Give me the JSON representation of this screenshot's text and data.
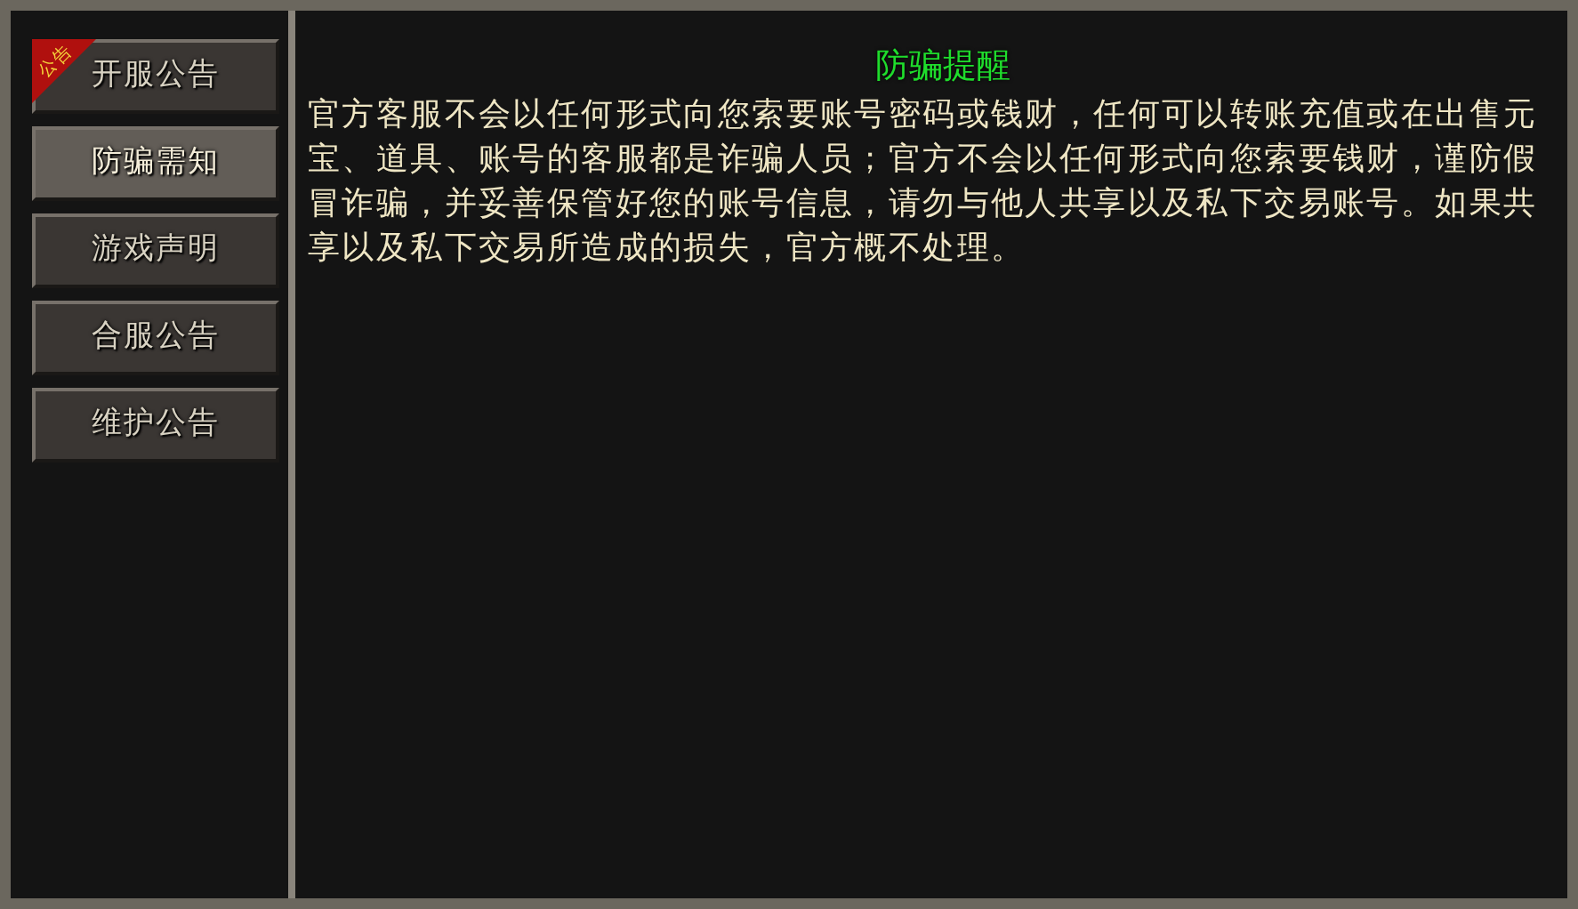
{
  "sidebar": {
    "items": [
      {
        "label": "开服公告",
        "selected": false,
        "badge": "公告"
      },
      {
        "label": "防骗需知",
        "selected": true
      },
      {
        "label": "游戏声明",
        "selected": false
      },
      {
        "label": "合服公告",
        "selected": false
      },
      {
        "label": "维护公告",
        "selected": false
      }
    ]
  },
  "content": {
    "title": "防骗提醒",
    "body": "官方客服不会以任何形式向您索要账号密码或钱财，任何可以转账充值或在出售元宝、道具、账号的客服都是诈骗人员；官方不会以任何形式向您索要钱财，谨防假冒诈骗，并妥善保管好您的账号信息，请勿与他人共享以及私下交易账号。如果共享以及私下交易所造成的损失，官方概不处理。"
  }
}
